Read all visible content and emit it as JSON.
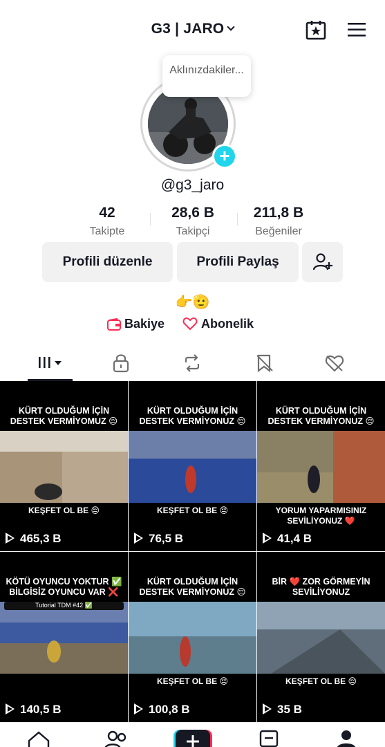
{
  "header": {
    "account_name": "G3 | JARO",
    "icons": [
      "calendar-star-icon",
      "menu-icon"
    ]
  },
  "profile": {
    "bubble_text": "Aklınızdakiler...",
    "handle": "@g3_jaro",
    "bio": "👉🫡"
  },
  "stats": [
    {
      "value": "42",
      "label": "Takipte"
    },
    {
      "value": "28,6 B",
      "label": "Takipçi"
    },
    {
      "value": "211,8 B",
      "label": "Beğeniler"
    }
  ],
  "buttons": {
    "edit": "Profili düzenle",
    "share": "Profili Paylaş"
  },
  "links": {
    "balance": "Bakiye",
    "subscription": "Abonelik"
  },
  "tabs": [
    "videos-tab-icon",
    "lock-icon",
    "repost-icon",
    "saved-icon",
    "liked-icon"
  ],
  "videos": [
    {
      "top": "KÜRT OLDUĞUM İÇİN DESTEK VERMİYOMUZ 😔",
      "bottom": "KEŞFET OL BE 😔",
      "views": "465,3 B"
    },
    {
      "top": "KÜRT OLDUĞUM İÇİN DESTEK VERMİYONUZ 😔",
      "bottom": "KEŞFET OL BE 😔",
      "views": "76,5 B"
    },
    {
      "top": "KÜRT OLDUĞUM İÇİN DESTEK VERMİYONUZ 😔",
      "bottom": "YORUM YAPARMISINIZ SEVİLİYONUZ ❤️",
      "views": "41,4 B"
    },
    {
      "top": "KÖTÜ OYUNCU YOKTUR ✅ BİLGİSİZ OYUNCU VAR ❌",
      "inset": "Tutorial TDM #42 ✅",
      "bottom": "",
      "views": "140,5 B"
    },
    {
      "top": "KÜRT OLDUĞUM İÇİN DESTEK VERMİYONUZ 😔",
      "bottom": "KEŞFET OL BE 😔",
      "views": "100,8 B"
    },
    {
      "top": "BİR ❤️ ZOR GÖRMEYİN SEVİLİYONUZ",
      "bottom": "KEŞFET OL BE 😔",
      "views": "35 B"
    }
  ],
  "colors": {
    "accent_cyan": "#20d5ec",
    "accent_red": "#fe2c55",
    "button_bg": "#f1f1f2"
  }
}
